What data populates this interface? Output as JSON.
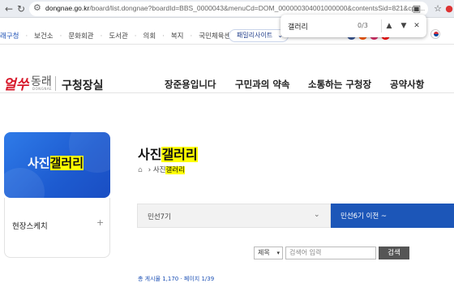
{
  "browser": {
    "url_host": "dongnae.go.kr",
    "url_rest": "/board/list.dongnae?boardId=BBS_0000043&menuCd=DOM_000000304001000000&contentsSid=821&cpa..."
  },
  "findbar": {
    "query": "갤러리",
    "count": "0/3",
    "prev_icon": "▲",
    "next_icon": "▼",
    "close_icon": "✕"
  },
  "utility": {
    "items": [
      "래구청",
      "보건소",
      "문화회관",
      "도서관",
      "의회",
      "복지",
      "국민체육센터"
    ],
    "family_label": "패밀리사이트",
    "sns": [
      "f",
      "b",
      "i",
      "y"
    ],
    "sns_colors": [
      "#3b5998",
      "#ff5a00",
      "#e1306c",
      "#ff0000"
    ]
  },
  "header": {
    "logo_main": "얼쑤",
    "logo_sub": "동래",
    "logo_eng": "DONGNAE",
    "site_name": "구청장실",
    "gnb": [
      "장준용입니다",
      "구민과의 약속",
      "소통하는 구청장",
      "공약사항"
    ]
  },
  "lnb": {
    "title_a": "사진",
    "title_b": "갤러리",
    "item": "현장스케치",
    "plus": "+"
  },
  "content": {
    "title_a": "사진",
    "title_b": "갤러리",
    "crumb_a": "사진",
    "crumb_b": "갤러리",
    "tab_prev": "민선7기",
    "tab_current": "민선6기 이전 ~",
    "search_select": "제목",
    "search_placeholder": "검색어 입력",
    "search_button": "검색",
    "cut_text": "총 게시물 1,170 · 페이지 1/39"
  }
}
